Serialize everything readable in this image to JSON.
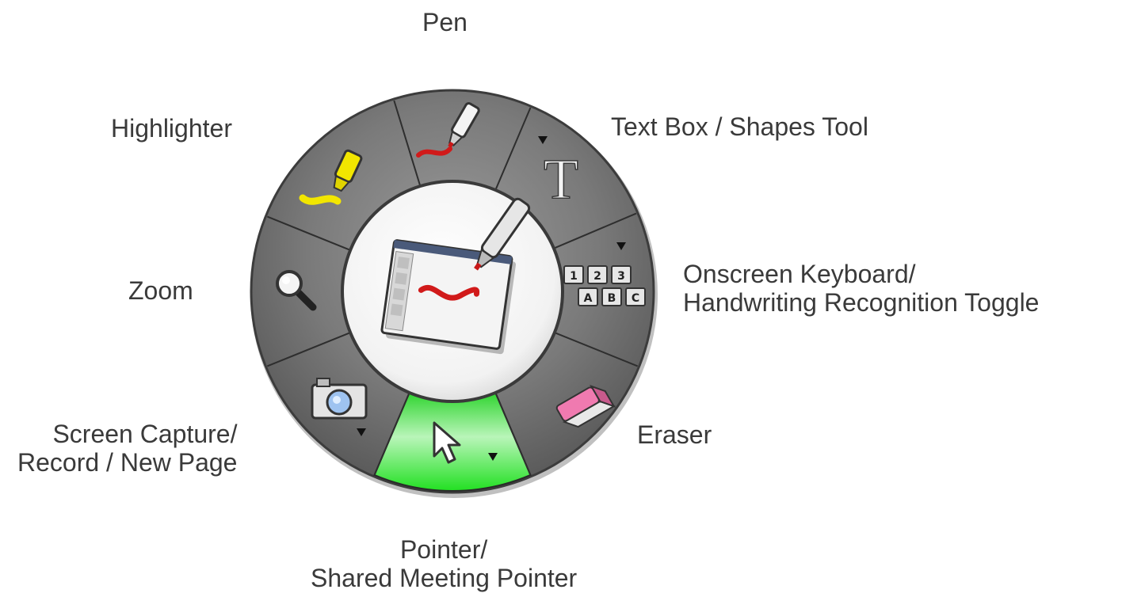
{
  "labels": {
    "pen": "Pen",
    "highlighter": "Highlighter",
    "text_box": "Text Box / Shapes Tool",
    "keyboard_line1": "Onscreen Keyboard/",
    "keyboard_line2": "Handwriting Recognition Toggle",
    "zoom": "Zoom",
    "eraser": "Eraser",
    "capture_line1": "Screen Capture/",
    "capture_line2": "Record / New Page",
    "pointer_line1": "Pointer/",
    "pointer_line2": "Shared Meeting Pointer"
  },
  "keyboard_icon": {
    "row1": [
      "1",
      "2",
      "3"
    ],
    "row2": [
      "A",
      "B",
      "C"
    ]
  },
  "text_tool_glyph": "T",
  "icons": {
    "center": "whiteboard-pen-icon",
    "pen": "pen-icon",
    "highlighter": "highlighter-icon",
    "text_box": "text-tool-icon",
    "keyboard": "keyboard-icon",
    "eraser": "eraser-icon",
    "pointer": "pointer-arrow-icon",
    "capture": "camera-icon",
    "zoom": "magnifier-icon"
  },
  "colors": {
    "ring": "#6e6e6e",
    "active_segment": "#33dd33",
    "highlighter_ink": "#f2e600",
    "pen_ink": "#d11a1a",
    "eraser_pink": "#f07ab0"
  },
  "active_tool": "pointer"
}
